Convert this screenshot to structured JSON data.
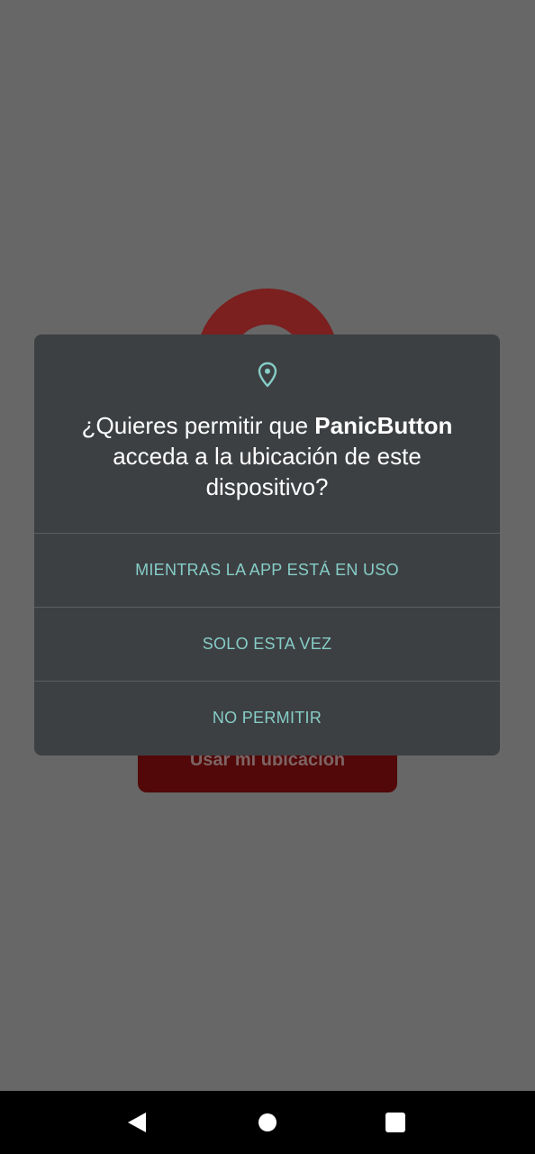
{
  "background_app": {
    "button_label": "Usar mi ubicación"
  },
  "dialog": {
    "icon": "location-pin-icon",
    "title_prefix": "¿Quieres permitir que ",
    "app_name": "PanicButton",
    "title_suffix": " acceda a la ubicación de este dispositivo?",
    "options": [
      "MIENTRAS LA APP ESTÁ EN USO",
      "SOLO ESTA VEZ",
      "NO PERMITIR"
    ]
  },
  "navigation_bar": {
    "buttons": [
      "back-icon",
      "home-icon",
      "recents-icon"
    ]
  },
  "colors": {
    "scrim": "#676767",
    "dialog_bg": "#3d4043",
    "accent": "#86cdc7",
    "app_red": "#7b1f1f"
  }
}
